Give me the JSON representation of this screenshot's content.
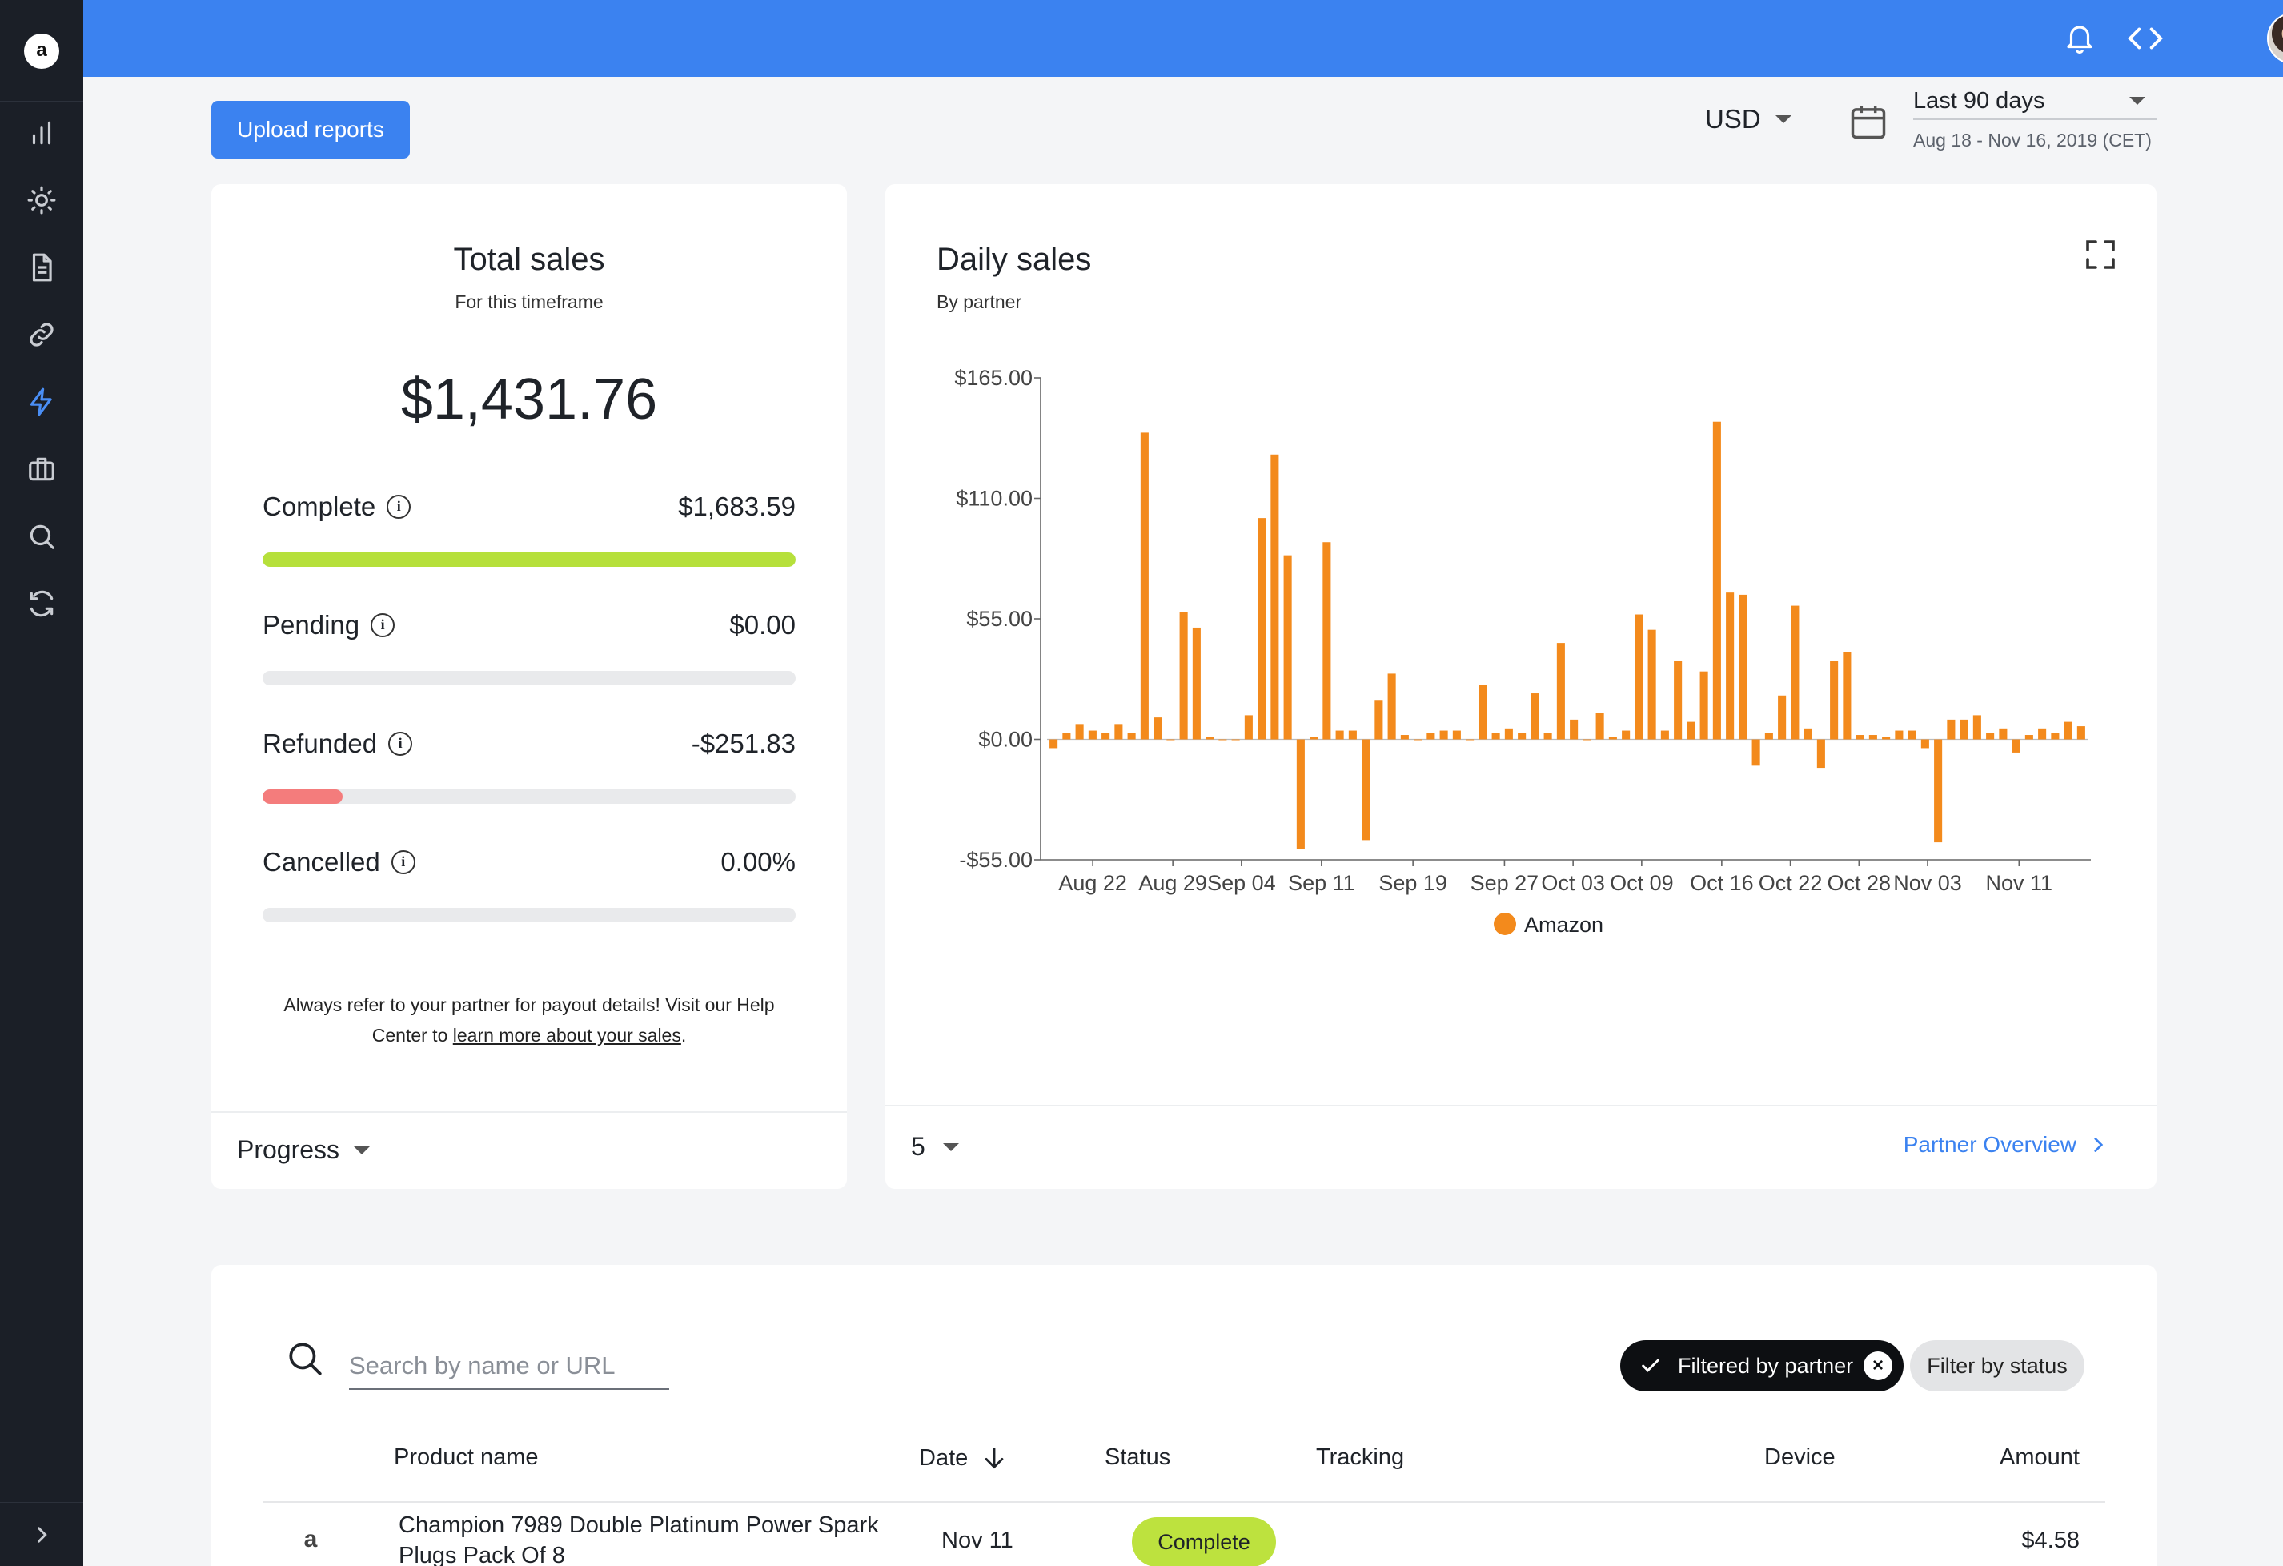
{
  "sidebar": {
    "logo_letter": "a",
    "items": [
      {
        "name": "reports",
        "icon": "bar-chart-icon"
      },
      {
        "name": "insights",
        "icon": "sun-icon"
      },
      {
        "name": "documents",
        "icon": "document-icon"
      },
      {
        "name": "links",
        "icon": "link-icon"
      },
      {
        "name": "sales",
        "icon": "lightning-icon",
        "active": true
      },
      {
        "name": "partners",
        "icon": "briefcase-icon"
      },
      {
        "name": "search",
        "icon": "search-icon"
      },
      {
        "name": "sync",
        "icon": "refresh-icon"
      }
    ],
    "expand_icon": "chevron-right-icon"
  },
  "topbar": {
    "icons": [
      "bell-icon",
      "code-icon",
      "avatar"
    ],
    "accent": "#3b82f0"
  },
  "toolbar": {
    "upload_label": "Upload reports",
    "currency": "USD",
    "range_label": "Last 90 days",
    "range_dates": "Aug 18 - Nov 16, 2019 (CET)"
  },
  "total_sales": {
    "title": "Total sales",
    "subtitle": "For this timeframe",
    "amount": "$1,431.76",
    "metrics": [
      {
        "label": "Complete",
        "value": "$1,683.59",
        "bar_fraction": 1.0,
        "color": "#b6e03b"
      },
      {
        "label": "Pending",
        "value": "$0.00",
        "bar_fraction": 0.0,
        "color": "#b6e03b"
      },
      {
        "label": "Refunded",
        "value": "-$251.83",
        "bar_fraction": 0.15,
        "color": "#f47c7c"
      },
      {
        "label": "Cancelled",
        "value": "0.00%",
        "bar_fraction": 0.0,
        "color": "#b6e03b"
      }
    ],
    "note_text": "Always refer to your partner for payout details! Visit our Help Center to ",
    "note_link": "learn more about your sales",
    "note_end": ".",
    "footer_dropdown": "Progress"
  },
  "daily_sales": {
    "title": "Daily sales",
    "subtitle": "By partner",
    "footer_rows": "5",
    "footer_link": "Partner Overview"
  },
  "chart_data": {
    "type": "bar",
    "title": "Daily sales",
    "subtitle": "By partner",
    "x_ticks": [
      "Aug 22",
      "Aug 29",
      "Sep 04",
      "Sep 11",
      "Sep 19",
      "Sep 27",
      "Oct 03",
      "Oct 09",
      "Oct 16",
      "Oct 22",
      "Oct 28",
      "Nov 03",
      "Nov 11"
    ],
    "y_ticks": [
      "$165.00",
      "$110.00",
      "$55.00",
      "$0.00",
      "-$55.00"
    ],
    "ylim": [
      -55,
      165
    ],
    "series": [
      {
        "name": "Amazon",
        "color": "#f38a1c",
        "values": [
          -4,
          3,
          7,
          4,
          3,
          7,
          3,
          140,
          10,
          0,
          58,
          51,
          1,
          0,
          0,
          11,
          101,
          130,
          84,
          -50,
          1,
          90,
          4,
          4,
          -46,
          18,
          30,
          2,
          0,
          3,
          4,
          4,
          0,
          25,
          3,
          5,
          3,
          21,
          3,
          44,
          9,
          0,
          12,
          1,
          4,
          57,
          50,
          4,
          36,
          8,
          31,
          145,
          67,
          66,
          -12,
          3,
          20,
          61,
          5,
          -13,
          36,
          40,
          2,
          2,
          1,
          4,
          4,
          -4,
          -47,
          9,
          9,
          11,
          3,
          5,
          -6,
          2,
          5,
          3,
          8,
          6
        ],
        "legend": "Amazon"
      }
    ],
    "x_start_date": "2019-08-18",
    "x_end_date": "2019-11-16",
    "grid": false,
    "legend_position": "bottom-center"
  },
  "table": {
    "search_placeholder": "Search by name or URL",
    "filter_partner": "Filtered by partner",
    "filter_status": "Filter by status",
    "columns": [
      "Product name",
      "Date",
      "Status",
      "Tracking",
      "Device",
      "Amount"
    ],
    "rows": [
      {
        "logo": "a",
        "product_line1": "Champion 7989 Double Platinum Power Spark",
        "product_line2": "Plugs Pack Of 8",
        "date": "Nov 11",
        "status": "Complete",
        "tracking": "",
        "device": "",
        "amount": "$4.58"
      }
    ]
  }
}
